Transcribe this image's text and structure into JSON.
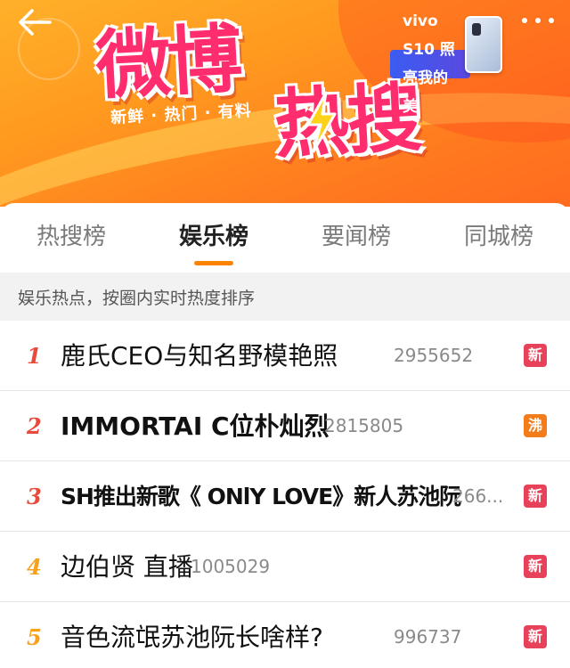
{
  "header": {
    "logo_text": "微博",
    "logo_hot": "热搜",
    "slogan": "新鲜 · 热门 · 有料",
    "sponsor": "vivo S10 照亮我的美",
    "back_icon": "arrow-left-icon",
    "more_icon": "more-dots-icon"
  },
  "tabs": [
    {
      "label": "热搜榜",
      "active": false
    },
    {
      "label": "娱乐榜",
      "active": true
    },
    {
      "label": "要闻榜",
      "active": false
    },
    {
      "label": "同城榜",
      "active": false
    }
  ],
  "section_title": "娱乐热点，按圈内实时热度排序",
  "list": [
    {
      "rank": "1",
      "title": "鹿氏CEO与知名野模艳照",
      "heat": "2955652",
      "badge": "新",
      "badge_type": "new"
    },
    {
      "rank": "2",
      "title": "IMMORTAI C位朴灿烈",
      "heat": "2815805",
      "badge": "沸",
      "badge_type": "boil"
    },
    {
      "rank": "3",
      "title": "SH推出新歌《 ONlY LOVE》新人苏池阮",
      "heat": "266...",
      "badge": "新",
      "badge_type": "new"
    },
    {
      "rank": "4",
      "title": "边伯贤 直播",
      "heat": "1005029",
      "badge": "新",
      "badge_type": "new"
    },
    {
      "rank": "5",
      "title": "音色流氓苏池阮长啥样?",
      "heat": "996737",
      "badge": "新",
      "badge_type": "new"
    }
  ],
  "colors": {
    "accent": "#ff8200",
    "rank_top3": "#e84a3c",
    "rank_other": "#f7a11a",
    "badge_new": "#e8425a",
    "badge_boil": "#f27d1a",
    "logo_pink": "#ff2d6d"
  }
}
